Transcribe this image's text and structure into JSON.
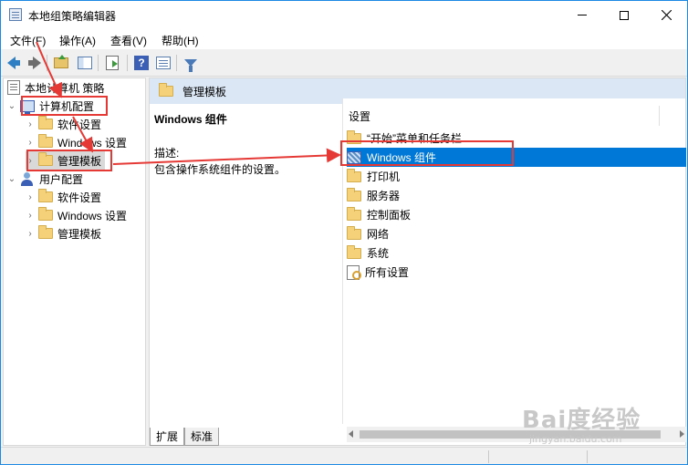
{
  "window": {
    "title": "本地组策略编辑器"
  },
  "menu": [
    {
      "label": "文件(F)"
    },
    {
      "label": "操作(A)"
    },
    {
      "label": "查看(V)"
    },
    {
      "label": "帮助(H)"
    }
  ],
  "toolbar": {
    "help_glyph": "?"
  },
  "tree": {
    "root": "本地计算机 策略",
    "computer_config": "计算机配置",
    "computer_children": [
      "软件设置",
      "Windows 设置",
      "管理模板"
    ],
    "user_config": "用户配置",
    "user_children": [
      "软件设置",
      "Windows 设置",
      "管理模板"
    ]
  },
  "right_pane": {
    "header": "管理模板",
    "description_title": "Windows 组件",
    "description_label": "描述:",
    "description_text": "包含操作系统组件的设置。",
    "column_header": "设置",
    "items": [
      {
        "label": "“开始”菜单和任务栏",
        "icon": "folder-icon",
        "selected": false
      },
      {
        "label": "Windows 组件",
        "icon": "windows-components-icon",
        "selected": true
      },
      {
        "label": "打印机",
        "icon": "folder-icon",
        "selected": false
      },
      {
        "label": "服务器",
        "icon": "folder-icon",
        "selected": false
      },
      {
        "label": "控制面板",
        "icon": "folder-icon",
        "selected": false
      },
      {
        "label": "网络",
        "icon": "folder-icon",
        "selected": false
      },
      {
        "label": "系统",
        "icon": "folder-icon",
        "selected": false
      },
      {
        "label": "所有设置",
        "icon": "all-settings-icon",
        "selected": false
      }
    ]
  },
  "tabs": [
    {
      "label": "扩展",
      "active": true
    },
    {
      "label": "标准",
      "active": false
    }
  ],
  "watermark": {
    "main": "Bai度经验",
    "sub": "jingyan.baidu.com"
  },
  "colors": {
    "selection": "#0078d7",
    "annotation": "#e53935",
    "header_band": "#dbe7f5"
  }
}
